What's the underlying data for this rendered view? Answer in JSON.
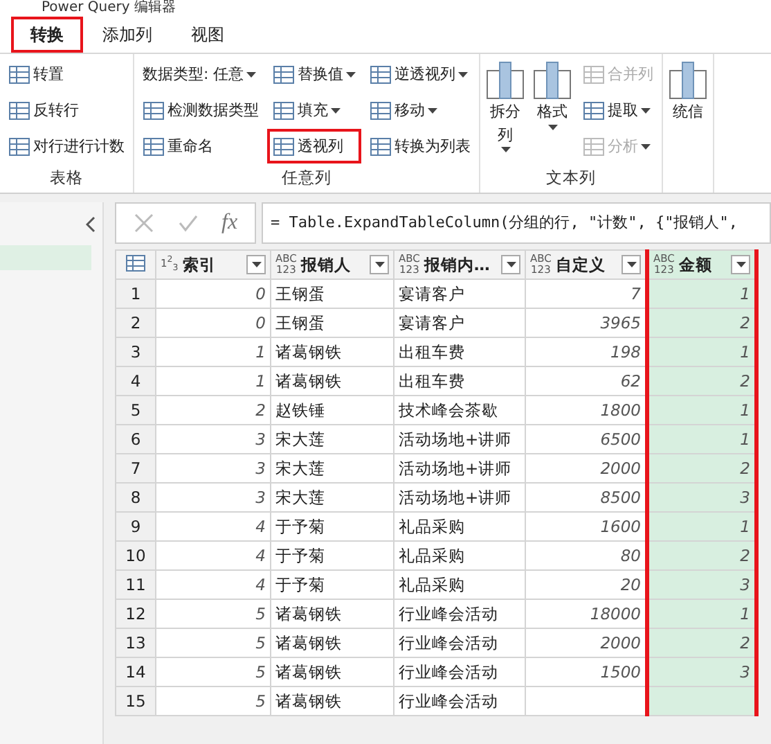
{
  "window": {
    "title": "Power Query 编辑器"
  },
  "tabs": [
    {
      "label": "转换",
      "selected": true,
      "highlighted": true
    },
    {
      "label": "添加列",
      "selected": false,
      "highlighted": false
    },
    {
      "label": "视图",
      "selected": false,
      "highlighted": false
    }
  ],
  "ribbon": [
    {
      "label": "表格",
      "columns": [
        [
          {
            "kind": "small",
            "label": "转置",
            "dropdown": false,
            "disabled": false,
            "highlighted": false
          },
          {
            "kind": "small",
            "label": "反转行",
            "dropdown": false,
            "disabled": false,
            "highlighted": false
          },
          {
            "kind": "small",
            "label": "对行进行计数",
            "dropdown": false,
            "disabled": false,
            "highlighted": false
          }
        ]
      ]
    },
    {
      "label": "任意列",
      "columns": [
        [
          {
            "kind": "small",
            "label": "数据类型: 任意",
            "dropdown": true,
            "disabled": false,
            "highlighted": false,
            "noicon": true
          },
          {
            "kind": "small",
            "label": "检测数据类型",
            "dropdown": false,
            "disabled": false,
            "highlighted": false
          },
          {
            "kind": "small",
            "label": "重命名",
            "dropdown": false,
            "disabled": false,
            "highlighted": false
          }
        ],
        [
          {
            "kind": "small",
            "label": "替换值",
            "dropdown": true,
            "disabled": false,
            "highlighted": false
          },
          {
            "kind": "small",
            "label": "填充",
            "dropdown": true,
            "disabled": false,
            "highlighted": false
          },
          {
            "kind": "small",
            "label": "透视列",
            "dropdown": false,
            "disabled": false,
            "highlighted": true
          }
        ],
        [
          {
            "kind": "small",
            "label": "逆透视列",
            "dropdown": true,
            "disabled": false,
            "highlighted": false
          },
          {
            "kind": "small",
            "label": "移动",
            "dropdown": true,
            "disabled": false,
            "highlighted": false
          },
          {
            "kind": "small",
            "label": "转换为列表",
            "dropdown": false,
            "disabled": false,
            "highlighted": false
          }
        ]
      ]
    },
    {
      "label": "文本列",
      "columns": [
        [
          {
            "kind": "large",
            "label": "拆分列",
            "dropdown": true,
            "disabled": false,
            "highlighted": false
          }
        ],
        [
          {
            "kind": "large",
            "label": "格式",
            "dropdown": true,
            "disabled": false,
            "highlighted": false
          }
        ],
        [
          {
            "kind": "small",
            "label": "合并列",
            "dropdown": false,
            "disabled": true,
            "highlighted": false
          },
          {
            "kind": "small",
            "label": "提取",
            "dropdown": true,
            "disabled": false,
            "highlighted": false
          },
          {
            "kind": "small",
            "label": "分析",
            "dropdown": true,
            "disabled": true,
            "highlighted": false
          }
        ]
      ]
    },
    {
      "columns": [
        [
          {
            "kind": "large",
            "label": "统信",
            "dropdown": false,
            "disabled": false,
            "highlighted": false
          }
        ]
      ]
    }
  ],
  "formula_symbol": "fx",
  "formula": "= Table.ExpandTableColumn(分组的行, \"计数\", {\"报销人\",",
  "table": {
    "columns": [
      {
        "type": "1$^{2}$$_{3}$",
        "label": "索引",
        "kind": "number",
        "highlighted": false
      },
      {
        "type": "ABC 123",
        "label": "报销人",
        "kind": "text",
        "highlighted": false
      },
      {
        "type": "ABC 123",
        "label": "报销内…",
        "kind": "text",
        "highlighted": false
      },
      {
        "type": "ABC 123",
        "label": "自定义",
        "kind": "number",
        "highlighted": false
      },
      {
        "type": "ABC 123",
        "label": "金额",
        "kind": "number",
        "highlighted": true
      }
    ],
    "rows": [
      {
        "number": "1",
        "cells": [
          "0",
          "王钢蛋",
          "宴请客户",
          "7",
          "1"
        ]
      },
      {
        "number": "2",
        "cells": [
          "0",
          "王钢蛋",
          "宴请客户",
          "3965",
          "2"
        ]
      },
      {
        "number": "3",
        "cells": [
          "1",
          "诸葛钢铁",
          "出租车费",
          "198",
          "1"
        ]
      },
      {
        "number": "4",
        "cells": [
          "1",
          "诸葛钢铁",
          "出租车费",
          "62",
          "2"
        ]
      },
      {
        "number": "5",
        "cells": [
          "2",
          "赵铁锤",
          "技术峰会茶歇",
          "1800",
          "1"
        ]
      },
      {
        "number": "6",
        "cells": [
          "3",
          "宋大莲",
          "活动场地+讲师",
          "6500",
          "1"
        ]
      },
      {
        "number": "7",
        "cells": [
          "3",
          "宋大莲",
          "活动场地+讲师",
          "2000",
          "2"
        ]
      },
      {
        "number": "8",
        "cells": [
          "3",
          "宋大莲",
          "活动场地+讲师",
          "8500",
          "3"
        ]
      },
      {
        "number": "9",
        "cells": [
          "4",
          "于予菊",
          "礼品采购",
          "1600",
          "1"
        ]
      },
      {
        "number": "10",
        "cells": [
          "4",
          "于予菊",
          "礼品采购",
          "80",
          "2"
        ]
      },
      {
        "number": "11",
        "cells": [
          "4",
          "于予菊",
          "礼品采购",
          "20",
          "3"
        ]
      },
      {
        "number": "12",
        "cells": [
          "5",
          "诸葛钢铁",
          "行业峰会活动",
          "18000",
          "1"
        ]
      },
      {
        "number": "13",
        "cells": [
          "5",
          "诸葛钢铁",
          "行业峰会活动",
          "2000",
          "2"
        ]
      },
      {
        "number": "14",
        "cells": [
          "5",
          "诸葛钢铁",
          "行业峰会活动",
          "1500",
          "3"
        ]
      },
      {
        "number": "15",
        "cells": [
          "5",
          "诸葛钢铁",
          "行业峰会活动",
          null,
          null
        ]
      }
    ]
  }
}
